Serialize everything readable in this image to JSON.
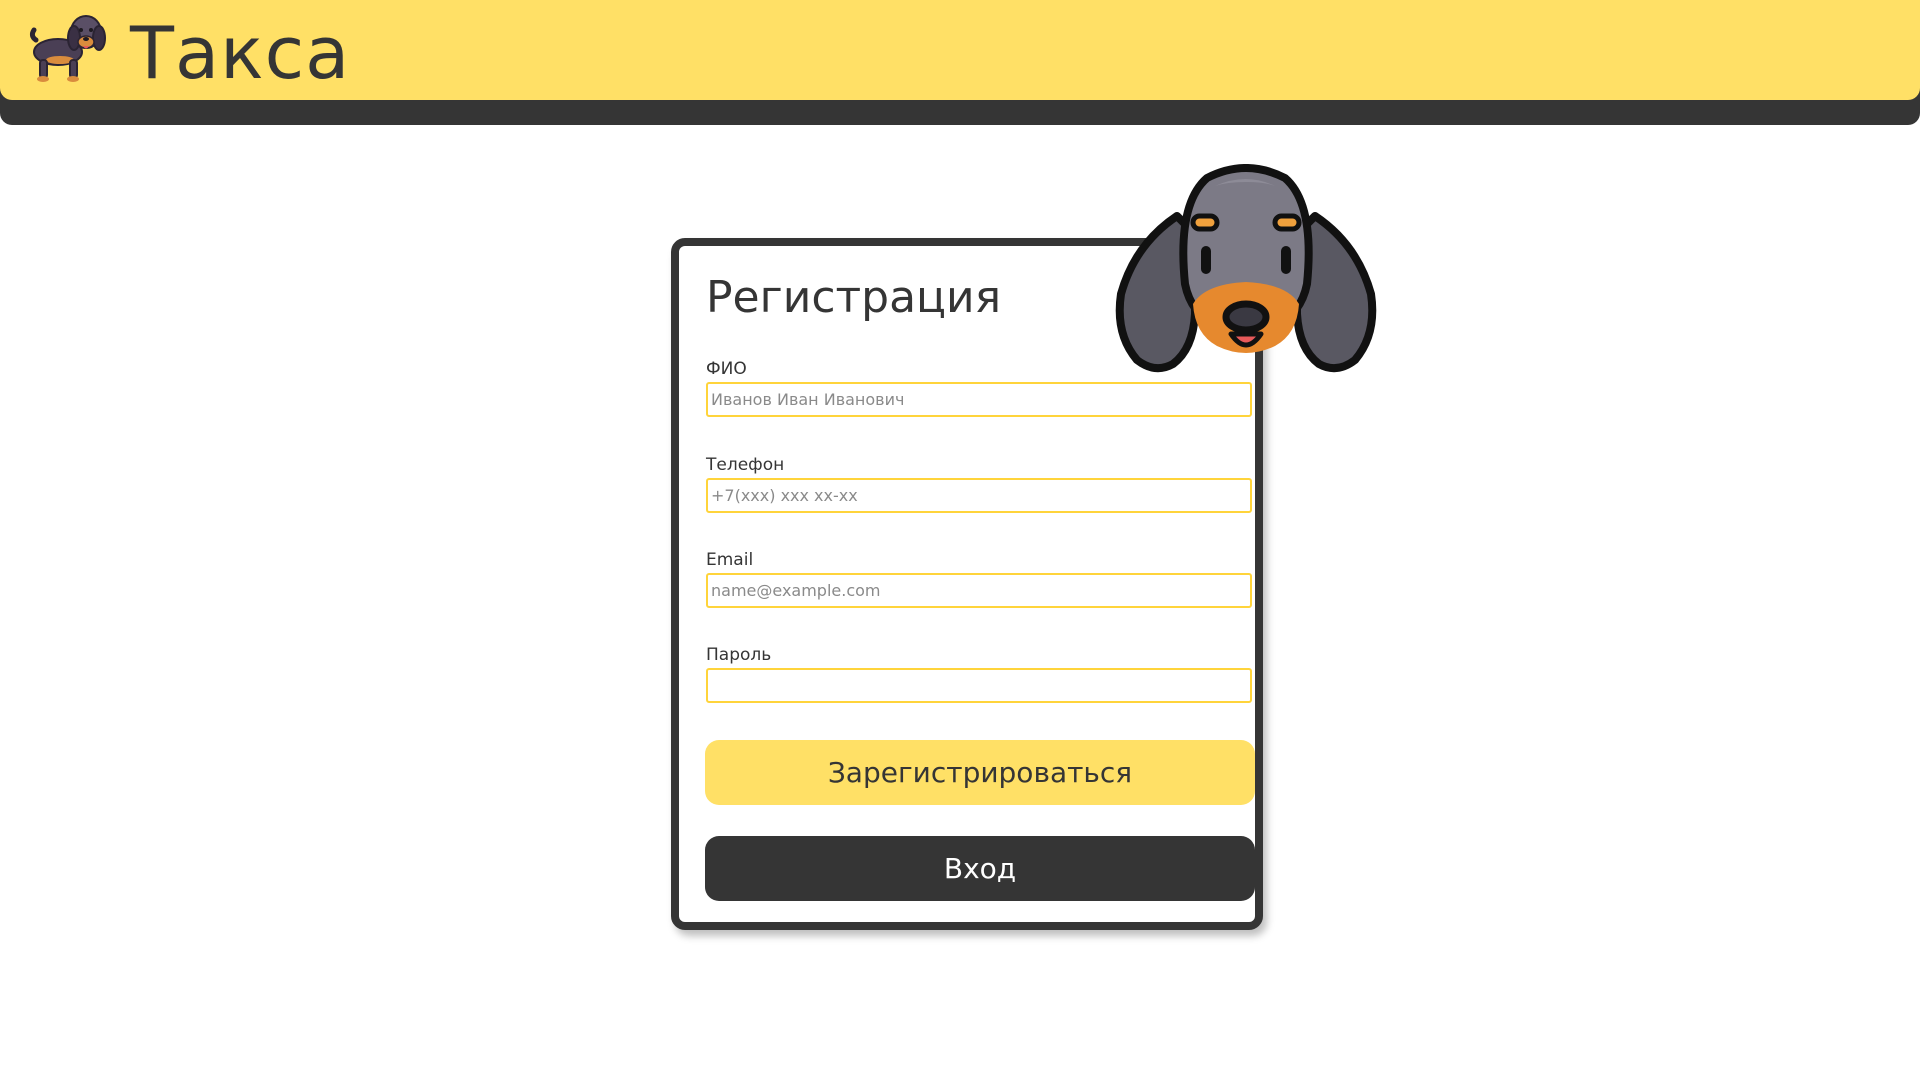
{
  "header": {
    "brand": "Такса",
    "logo_icon": "dachshund-icon"
  },
  "form": {
    "title": "Регистрация",
    "fields": [
      {
        "label": "ФИО",
        "placeholder": "Иванов Иван Иванович",
        "value": ""
      },
      {
        "label": "Телефон",
        "placeholder": "+7(xxx) xxx xx-xx",
        "value": ""
      },
      {
        "label": "Email",
        "placeholder": "name@example.com",
        "value": ""
      },
      {
        "label": "Пароль",
        "placeholder": "",
        "value": ""
      }
    ],
    "register_button": "Зарегистрироваться",
    "login_button": "Вход",
    "mascot_icon": "dog-face-icon"
  },
  "colors": {
    "accent": "#ffe066",
    "input_border": "#ffd43b",
    "dark": "#353535",
    "background": "#ffffff"
  }
}
